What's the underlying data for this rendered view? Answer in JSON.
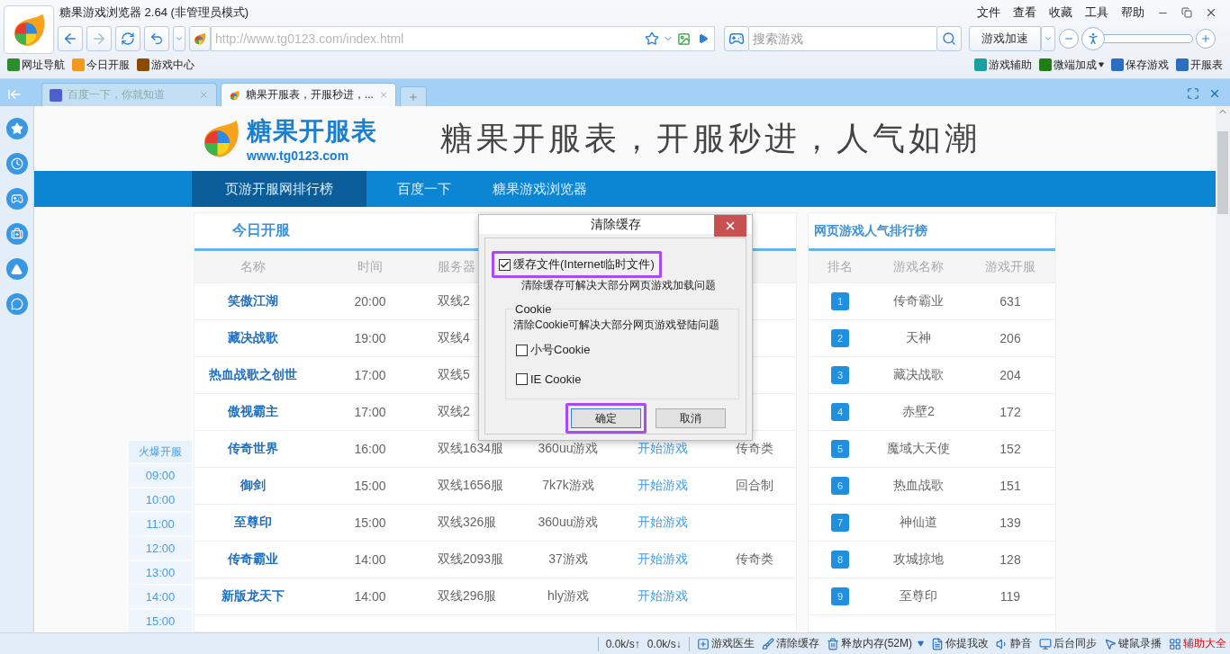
{
  "window": {
    "title": "糖果游戏浏览器 2.64 (非管理员模式)",
    "menu": [
      "文件",
      "查看",
      "收藏",
      "工具",
      "帮助"
    ]
  },
  "toolbar": {
    "address": "http://www.tg0123.com/index.html",
    "search_placeholder": "搜索游戏",
    "speed_button": "游戏加速",
    "zoom": {
      "level": 0
    }
  },
  "bookmarks": {
    "left": [
      {
        "label": "网址导航",
        "kind": "hao"
      },
      {
        "label": "今日开服",
        "kind": "candy"
      },
      {
        "label": "游戏中心",
        "kind": "g"
      }
    ],
    "right": [
      {
        "label": "游戏辅助",
        "kind": "grid"
      },
      {
        "label": "微端加成",
        "kind": "wei",
        "dropdown": true
      },
      {
        "label": "保存游戏",
        "kind": "doc"
      },
      {
        "label": "开服表",
        "kind": "table"
      }
    ]
  },
  "tabs": [
    {
      "label": "百度一下，你就知道",
      "selected": false
    },
    {
      "label": "糖果开服表，开服秒进，...",
      "selected": true
    }
  ],
  "page": {
    "logo_title": "糖果开服表",
    "logo_url": "www.tg0123.com",
    "slogan": "糖果开服表，开服秒进，人气如潮",
    "nav": [
      {
        "label": "页游开服网排行榜",
        "selected": true
      },
      {
        "label": "百度一下",
        "selected": false
      },
      {
        "label": "糖果游戏浏览器",
        "selected": false
      }
    ],
    "today": {
      "title": "今日开服",
      "columns": [
        "名称",
        "时间",
        "服务器"
      ],
      "rows": [
        {
          "cells": [
            "笑傲江湖",
            "20:00",
            "双线2"
          ]
        },
        {
          "cells": [
            "藏决战歌",
            "19:00",
            "双线4"
          ]
        },
        {
          "cells": [
            "热血战歌之创世",
            "17:00",
            "双线5"
          ]
        },
        {
          "cells": [
            "傲视霸主",
            "17:00",
            "双线2"
          ]
        },
        {
          "cells": [
            "传奇世界",
            "16:00",
            "双线1634服",
            "360uu游戏",
            "开始游戏",
            "传奇类"
          ]
        },
        {
          "cells": [
            "御剑",
            "15:00",
            "双线1656服",
            "7k7k游戏",
            "开始游戏",
            "回合制"
          ]
        },
        {
          "cells": [
            "至尊印",
            "15:00",
            "双线326服",
            "360uu游戏",
            "开始游戏"
          ]
        },
        {
          "cells": [
            "传奇霸业",
            "14:00",
            "双线2093服",
            "37游戏",
            "开始游戏",
            "传奇类"
          ]
        },
        {
          "cells": [
            "新版龙天下",
            "14:00",
            "双线296服",
            "hly游戏",
            "开始游戏"
          ]
        }
      ]
    },
    "hot": {
      "title": "火爆开服",
      "times": [
        "09:00",
        "10:00",
        "11:00",
        "12:00",
        "13:00",
        "14:00",
        "15:00"
      ]
    },
    "ranking": {
      "title": "网页游戏人气排行榜",
      "columns": [
        "排名",
        "游戏名称",
        "游戏开服"
      ],
      "rows": [
        {
          "rank": "1",
          "name": "传奇霸业",
          "count": "631"
        },
        {
          "rank": "2",
          "name": "天神",
          "count": "206"
        },
        {
          "rank": "3",
          "name": "藏决战歌",
          "count": "204"
        },
        {
          "rank": "4",
          "name": "赤壁2",
          "count": "172"
        },
        {
          "rank": "5",
          "name": "魔域大天使",
          "count": "152"
        },
        {
          "rank": "6",
          "name": "热血战歌",
          "count": "151"
        },
        {
          "rank": "7",
          "name": "神仙道",
          "count": "139"
        },
        {
          "rank": "8",
          "name": "攻城掠地",
          "count": "128"
        },
        {
          "rank": "9",
          "name": "至尊印",
          "count": "119"
        }
      ]
    }
  },
  "dialog": {
    "title": "清除缓存",
    "option": {
      "label": "缓存文件(Internet临时文件)",
      "checked": true,
      "highlighted": true,
      "description": "清除缓存可解决大部分网页游戏加载问题"
    },
    "cookie_group": {
      "legend": "Cookie",
      "description": "清除Cookie可解决大部分网页游戏登陆问题",
      "options": [
        {
          "label": "小号Cookie",
          "checked": false
        },
        {
          "label": "IE Cookie",
          "checked": false
        }
      ]
    },
    "buttons": [
      {
        "label": "确定",
        "default": true,
        "highlighted": true
      },
      {
        "label": "取消",
        "default": false,
        "highlighted": false
      }
    ]
  },
  "status_bar": {
    "up": "0.0k/s↑",
    "down": "0.0k/s↓",
    "items": [
      {
        "label": "游戏医生",
        "kind": "plus",
        "emphasis": false
      },
      {
        "label": "清除缓存",
        "kind": "brush",
        "emphasis": false
      },
      {
        "label": "释放内存(52M)",
        "kind": "trash",
        "emphasis": false,
        "dropdown": true
      },
      {
        "label": "你提我改",
        "kind": "note",
        "emphasis": false
      },
      {
        "label": "静音",
        "kind": "speaker",
        "emphasis": false
      },
      {
        "label": "后台同步",
        "kind": "windows",
        "emphasis": false
      },
      {
        "label": "键鼠录播",
        "kind": "mouse",
        "emphasis": false
      },
      {
        "label": "辅助大全",
        "kind": "grid",
        "emphasis": true
      }
    ]
  }
}
